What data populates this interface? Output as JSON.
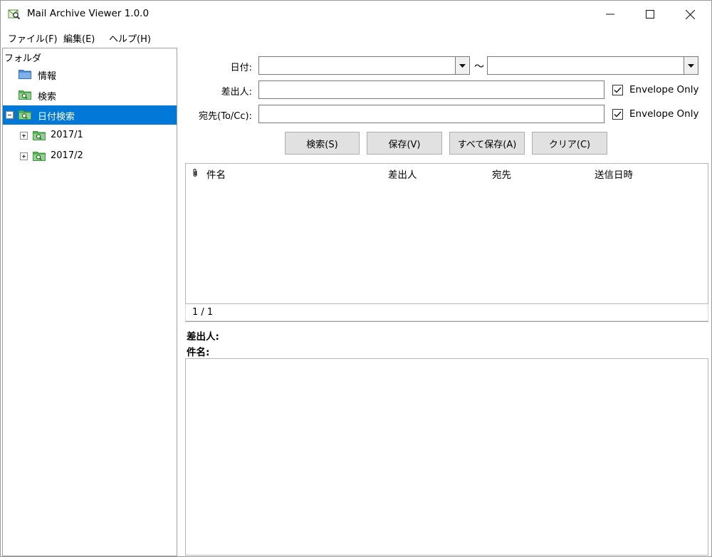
{
  "app": {
    "title": "Mail Archive Viewer 1.0.0"
  },
  "menu": {
    "items": [
      "ファイル(F)",
      "編集(E)",
      "ヘルプ(H)"
    ]
  },
  "tree": {
    "root_label": "フォルダ",
    "items": [
      {
        "label": "情報",
        "icon": "folder-icon"
      },
      {
        "label": "検索",
        "icon": "search-folder-icon"
      },
      {
        "label": "日付検索",
        "icon": "search-folder-icon",
        "selected": true
      },
      {
        "label": "2017/1",
        "icon": "search-folder-icon"
      },
      {
        "label": "2017/2",
        "icon": "search-folder-icon"
      }
    ]
  },
  "search": {
    "date_label": "日付:",
    "date_from_value": "",
    "date_to_value": "",
    "range_separator": "～",
    "from_label": "差出人:",
    "from_value": "",
    "to_label": "宛先(To/Cc):",
    "to_value": "",
    "envelope_only_label": "Envelope Only",
    "envelope_from_checked": true,
    "envelope_to_checked": true
  },
  "buttons": {
    "search": "検索(S)",
    "save": "保存(V)",
    "save_all": "すべて保存(A)",
    "clear": "クリア(C)"
  },
  "list": {
    "columns": [
      "件名",
      "差出人",
      "宛先",
      "送信日時"
    ],
    "rows": []
  },
  "pager": {
    "text": "1 / 1"
  },
  "detail": {
    "from_label": "差出人:",
    "subject_label": "件名:"
  },
  "colors": {
    "selection": "#0078d7",
    "folder": "#2f6fc0",
    "search_folder": "#3d9a3d"
  }
}
